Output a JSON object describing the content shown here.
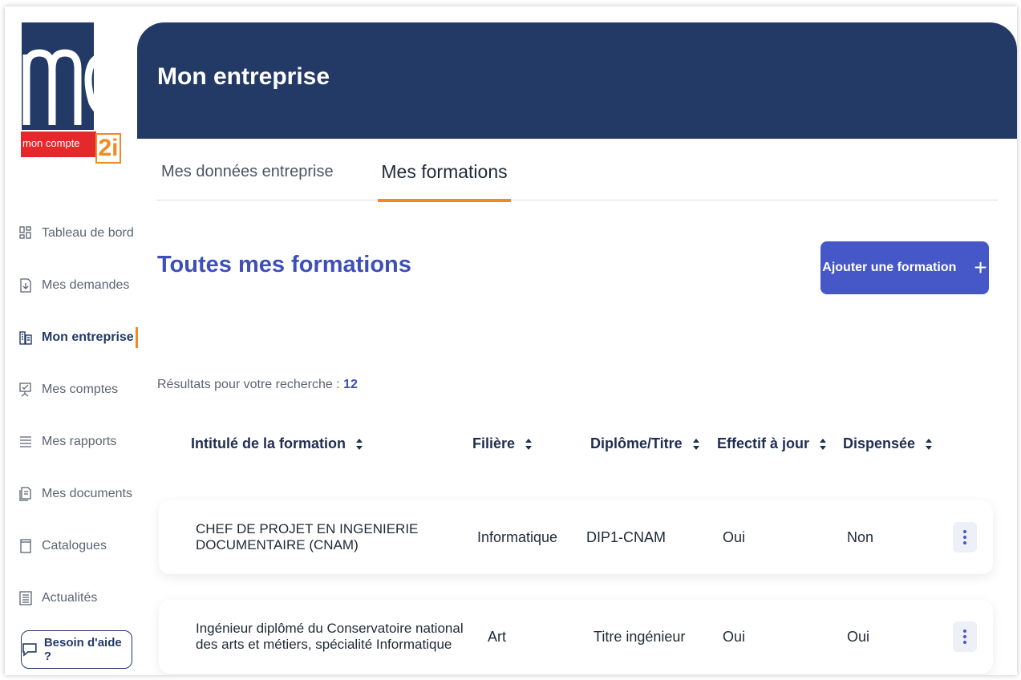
{
  "logo": {
    "strip_text": "mon compte",
    "badge_text": "2i"
  },
  "sidebar": {
    "items": [
      {
        "label": "Tableau de bord",
        "icon": "dashboard-icon"
      },
      {
        "label": "Mes demandes",
        "icon": "document-download-icon"
      },
      {
        "label": "Mon entreprise",
        "icon": "building-icon",
        "active": true
      },
      {
        "label": "Mes comptes",
        "icon": "account-check-icon"
      },
      {
        "label": "Mes rapports",
        "icon": "report-icon"
      },
      {
        "label": "Mes documents",
        "icon": "documents-icon"
      },
      {
        "label": "Catalogues",
        "icon": "catalog-icon"
      },
      {
        "label": "Actualités",
        "icon": "news-icon"
      }
    ],
    "help_label": "Besoin d'aide ?"
  },
  "header": {
    "title": "Mon entreprise"
  },
  "tabs": [
    {
      "label": "Mes données entreprise",
      "active": false
    },
    {
      "label": "Mes formations",
      "active": true
    }
  ],
  "main": {
    "section_title": "Toutes mes formations",
    "add_button_label": "Ajouter une formation",
    "results_label": "Résultats pour votre recherche :",
    "results_count": "12"
  },
  "table": {
    "columns": [
      "Intitulé de la formation",
      "Filière",
      "Diplôme/Titre",
      "Effectif à jour",
      "Dispensée"
    ],
    "rows": [
      {
        "title": "CHEF DE PROJET EN INGENIERIE DOCUMENTAIRE (CNAM)",
        "filiere": "Informatique",
        "diplome": "DIP1-CNAM",
        "effectif": "Oui",
        "dispensee": "Non"
      },
      {
        "title": "Ingénieur diplômé du Conservatoire national des arts et métiers, spécialité Informatique",
        "filiere": "Art",
        "diplome": "Titre ingénieur",
        "effectif": "Oui",
        "dispensee": "Oui"
      }
    ]
  },
  "colors": {
    "navy": "#233a66",
    "accent_orange": "#f08a24",
    "primary_blue": "#4658c8",
    "title_blue": "#3e4fb8",
    "logo_red": "#e5282b"
  }
}
